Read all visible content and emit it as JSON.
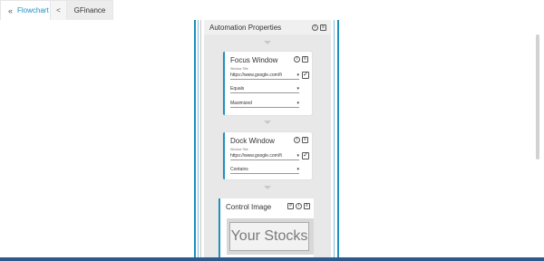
{
  "tabs": {
    "flowchart_label": "Flowchart",
    "back_label": "<",
    "active_label": "GFinance"
  },
  "panel": {
    "title": "Automation Properties"
  },
  "focus_card": {
    "title": "Focus Window",
    "window_title_label": "Window Title",
    "window_title_value": "https://www.google.com/fi",
    "match_value": "Equals",
    "state_value": "Maximized"
  },
  "dock_card": {
    "title": "Dock Window",
    "window_title_label": "Window Title",
    "window_title_value": "https://www.google.com/fi",
    "match_value": "Contains"
  },
  "image_card": {
    "title": "Control Image",
    "preview_text": "Your Stocks"
  },
  "colors": {
    "accent": "#1e8fbf",
    "taskbar": "#2d5a8c"
  }
}
